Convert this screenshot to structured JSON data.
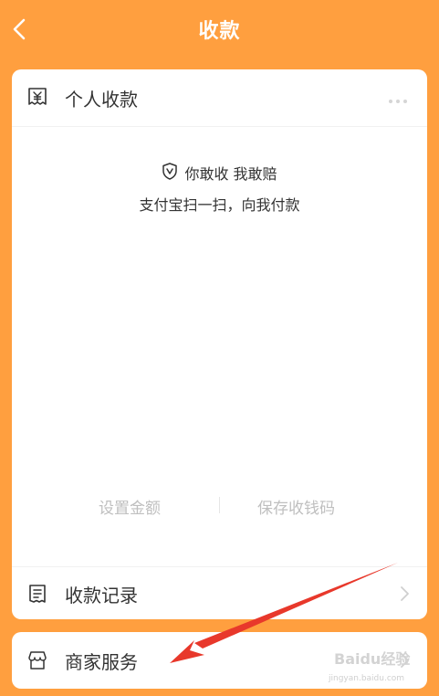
{
  "nav": {
    "title": "收款"
  },
  "personal": {
    "title": "个人收款",
    "guarantee": "你敢收 我敢赔",
    "hint": "支付宝扫一扫，向我付款",
    "set_amount": "设置金额",
    "save_code": "保存收钱码",
    "records": "收款记录"
  },
  "merchant": {
    "label": "商家服务"
  },
  "watermark": {
    "brand": "Baidu经验",
    "url": "jingyan.baidu.com"
  },
  "colors": {
    "background": "#FF9F3F",
    "card": "#FFFFFF",
    "annotation_arrow": "#E8382B"
  },
  "icons": [
    "back-chevron-icon",
    "yuan-receipt-icon",
    "more-dots-icon",
    "shield-v-icon",
    "receipt-list-icon",
    "chevron-right-icon",
    "store-icon"
  ]
}
